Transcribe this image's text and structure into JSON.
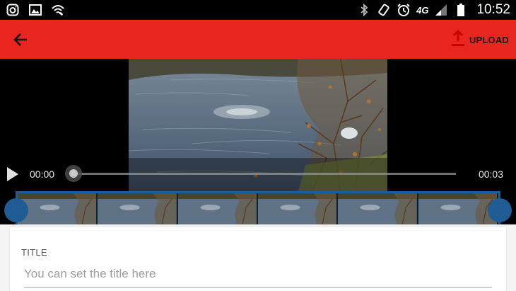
{
  "status_bar": {
    "left_icons": [
      "instagram-icon",
      "image-icon",
      "wifi-calling-icon"
    ],
    "right_icons": [
      "bluetooth-icon",
      "vibrate-icon",
      "alarm-icon",
      "network-4g-icon",
      "signal-icon",
      "battery-icon"
    ],
    "network_label": "4G",
    "time": "10:52"
  },
  "app_bar": {
    "background_color": "#e8251e",
    "back_icon": "arrow-left-icon",
    "upload_icon": "upload-icon",
    "upload_label": "UPLOAD"
  },
  "player": {
    "current_time": "00:00",
    "duration": "00:03",
    "progress_fraction": 0,
    "play_icon": "play-icon"
  },
  "trimmer": {
    "accent_color": "#1f5c93",
    "thumbnail_count": 6
  },
  "form": {
    "title_label": "TITLE",
    "title_placeholder": "You can set the title here",
    "title_value": ""
  }
}
